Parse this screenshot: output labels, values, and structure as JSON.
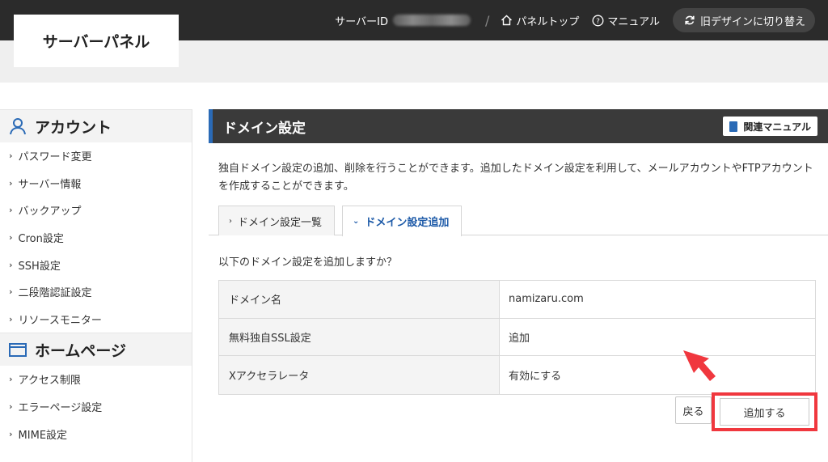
{
  "header": {
    "logo": "サーバーパネル",
    "server_id_label": "サーバーID",
    "separator": "/",
    "panel_top": "パネルトップ",
    "manual": "マニュアル",
    "old_design": "旧デザインに切り替え"
  },
  "sidebar": {
    "sections": [
      {
        "title": "アカウント",
        "icon": "user-icon",
        "items": [
          "パスワード変更",
          "サーバー情報",
          "バックアップ",
          "Cron設定",
          "SSH設定",
          "二段階認証設定",
          "リソースモニター"
        ]
      },
      {
        "title": "ホームページ",
        "icon": "window-icon",
        "items": [
          "アクセス制限",
          "エラーページ設定",
          "MIME設定"
        ]
      }
    ]
  },
  "main": {
    "title": "ドメイン設定",
    "manual_button": "関連マニュアル",
    "description": "独自ドメイン設定の追加、削除を行うことができます。追加したドメイン設定を利用して、メールアカウントやFTPアカウントを作成することができます。",
    "tabs": [
      {
        "label": "ドメイン設定一覧",
        "active": false
      },
      {
        "label": "ドメイン設定追加",
        "active": true
      }
    ],
    "confirm_text": "以下のドメイン設定を追加しますか？",
    "table": [
      {
        "label": "ドメイン名",
        "value": "namizaru.com"
      },
      {
        "label": "無料独自SSL設定",
        "value": "追加"
      },
      {
        "label": "Xアクセラレータ",
        "value": "有効にする"
      }
    ],
    "back_button": "戻る",
    "add_button": "追加する"
  },
  "colors": {
    "topbar": "#2b2b2b",
    "accent_blue": "#2a6ab6",
    "highlight_red": "#f0373e"
  }
}
